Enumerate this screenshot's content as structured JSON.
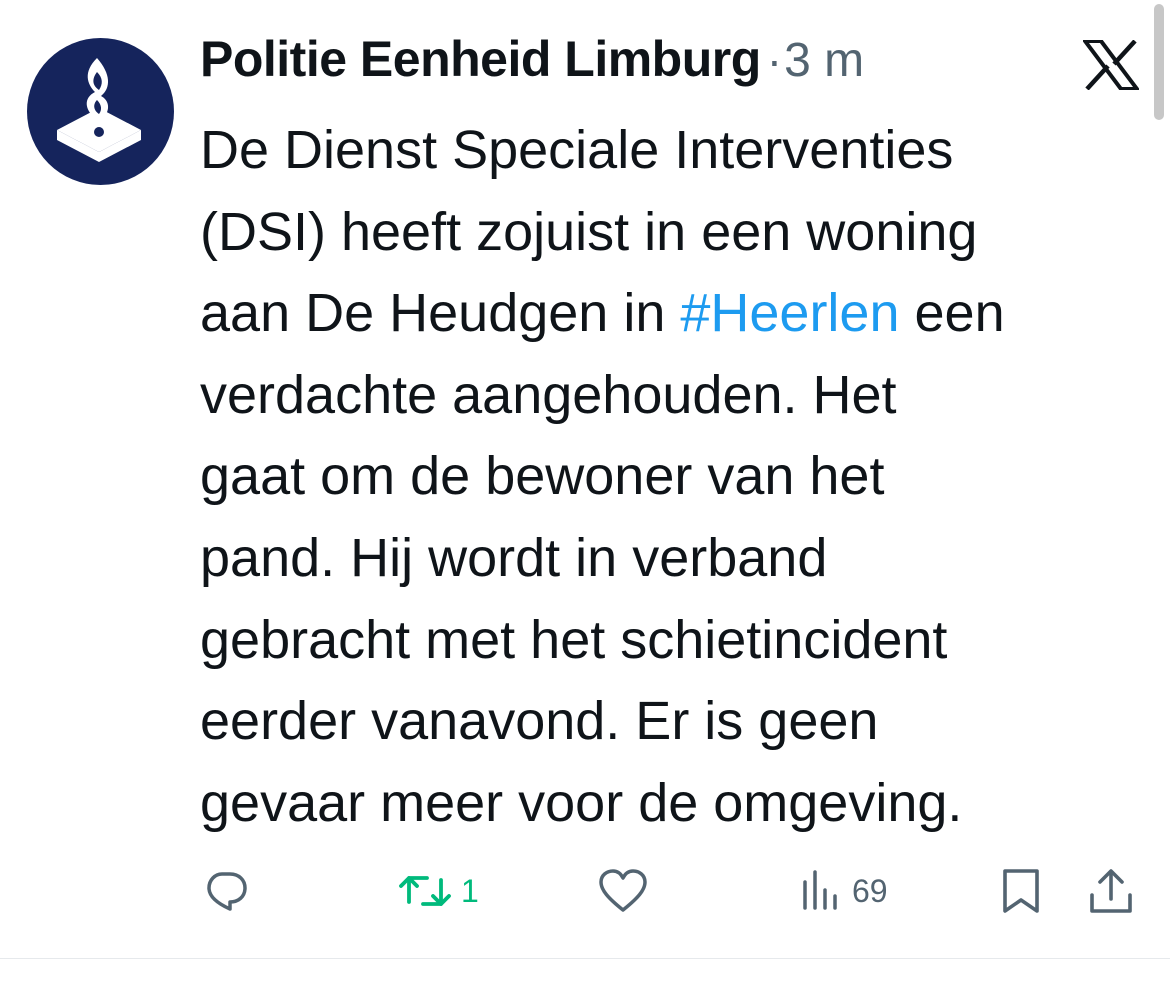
{
  "author": {
    "name": "Politie Eenheid Limburg",
    "separator": "·",
    "timestamp": "3 m",
    "avatar_icon": "police-flame-logo-icon",
    "avatar_color": "#15245c"
  },
  "platform_icon": "x-logo-icon",
  "tweet": {
    "lines": [
      {
        "text": "De Dienst Speciale Interventies"
      },
      {
        "text": "(DSI) heeft zojuist in een woning"
      },
      {
        "before": "aan De Heudgen in ",
        "hashtag": "#Heerlen",
        "after": " een"
      },
      {
        "text": "verdachte aangehouden. Het"
      },
      {
        "text": "gaat om de bewoner van het"
      },
      {
        "text": "pand. Hij wordt in verband"
      },
      {
        "text": "gebracht met het schietincident"
      },
      {
        "text": "eerder vanavond. Er is geen"
      },
      {
        "text": "gevaar meer voor de omgeving."
      }
    ]
  },
  "actions": {
    "reply": {
      "icon": "reply-icon"
    },
    "retweet": {
      "icon": "retweet-icon",
      "count": "1",
      "color": "#00ba7c"
    },
    "like": {
      "icon": "heart-icon"
    },
    "views": {
      "icon": "views-chart-icon",
      "count": "69"
    },
    "bookmark": {
      "icon": "bookmark-icon"
    },
    "share": {
      "icon": "share-icon"
    }
  },
  "colors": {
    "text": "#0f1419",
    "secondary": "#536471",
    "link": "#1d9bf0"
  }
}
